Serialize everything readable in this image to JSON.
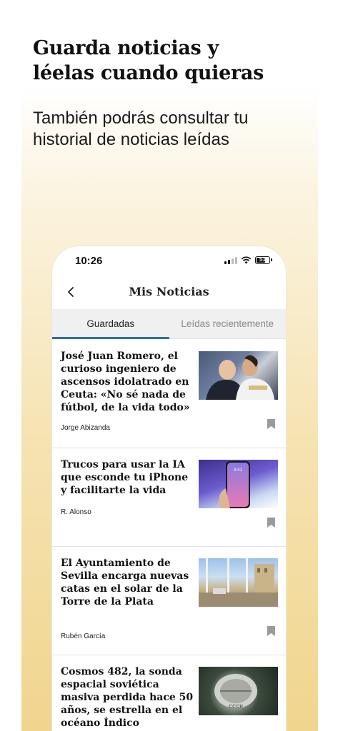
{
  "promo": {
    "headline": "Guarda noticias y\nléelas cuando quieras",
    "subtitle": "También podrás consultar tu\nhistorial de noticias leídas"
  },
  "status_bar": {
    "time": "10:26",
    "battery": "51",
    "icons": [
      "signal-icon",
      "wifi-icon",
      "battery-icon"
    ]
  },
  "nav": {
    "back_icon": "chevron-left-icon",
    "title": "Mis Noticias"
  },
  "tabs": [
    {
      "label": "Guardadas",
      "active": true
    },
    {
      "label": "Leídas recientemente",
      "active": false
    }
  ],
  "articles": [
    {
      "title": "José Juan Romero, el curioso ingeniero de ascensos idolatrado en Ceuta: «No sé nada de fútbol, de la vida todo»",
      "author": "Jorge Abizanda",
      "thumbnail": "two-men-embracing-photo"
    },
    {
      "title": "Trucos para usar la IA que esconde tu iPhone y facilitarte la vida",
      "author": "R. Alonso",
      "thumbnail": "iphone-in-hand-photo",
      "thumbnail_text": "9:41"
    },
    {
      "title": "El Ayuntamiento de Sevilla encarga nuevas catas en el solar de la Torre de la Plata",
      "author": "Rubén García",
      "thumbnail": "sevilla-tower-photo"
    },
    {
      "title": "Cosmos 482, la sonda espacial soviética masiva perdida hace 50 años, se estrella en el océano Índico",
      "author": "",
      "thumbnail": "soviet-probe-photo",
      "thumbnail_text": "CCCP"
    }
  ],
  "colors": {
    "tab_indicator": "#2c6fb0",
    "background_glow": "#f0d58e",
    "tab_bar_bg": "#f0f0f0"
  }
}
